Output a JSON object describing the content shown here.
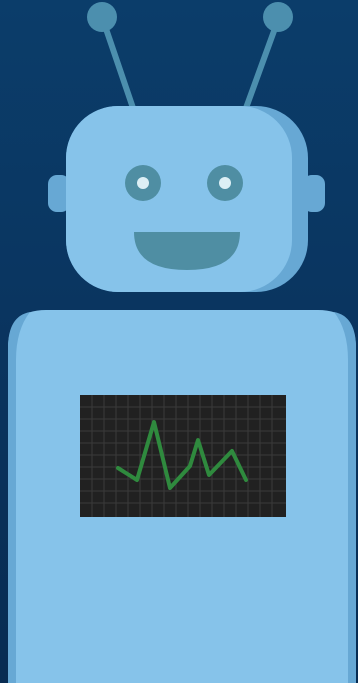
{
  "illustration": {
    "subject": "robot-icon",
    "colors": {
      "background_top": "#0b3d6a",
      "background_bottom": "#082c52",
      "body_light": "#86c3ea",
      "body_shade": "#67a8d4",
      "antenna": "#4c8fae",
      "eyes": "#4f8ea3",
      "eye_highlight": "#dceff5",
      "mouth": "#4f8ea3",
      "screen_bg": "#212121",
      "screen_grid": "#3a3a3a",
      "heartbeat": "#2f8a3e"
    },
    "screen": {
      "content": "heartbeat-line-icon"
    }
  }
}
